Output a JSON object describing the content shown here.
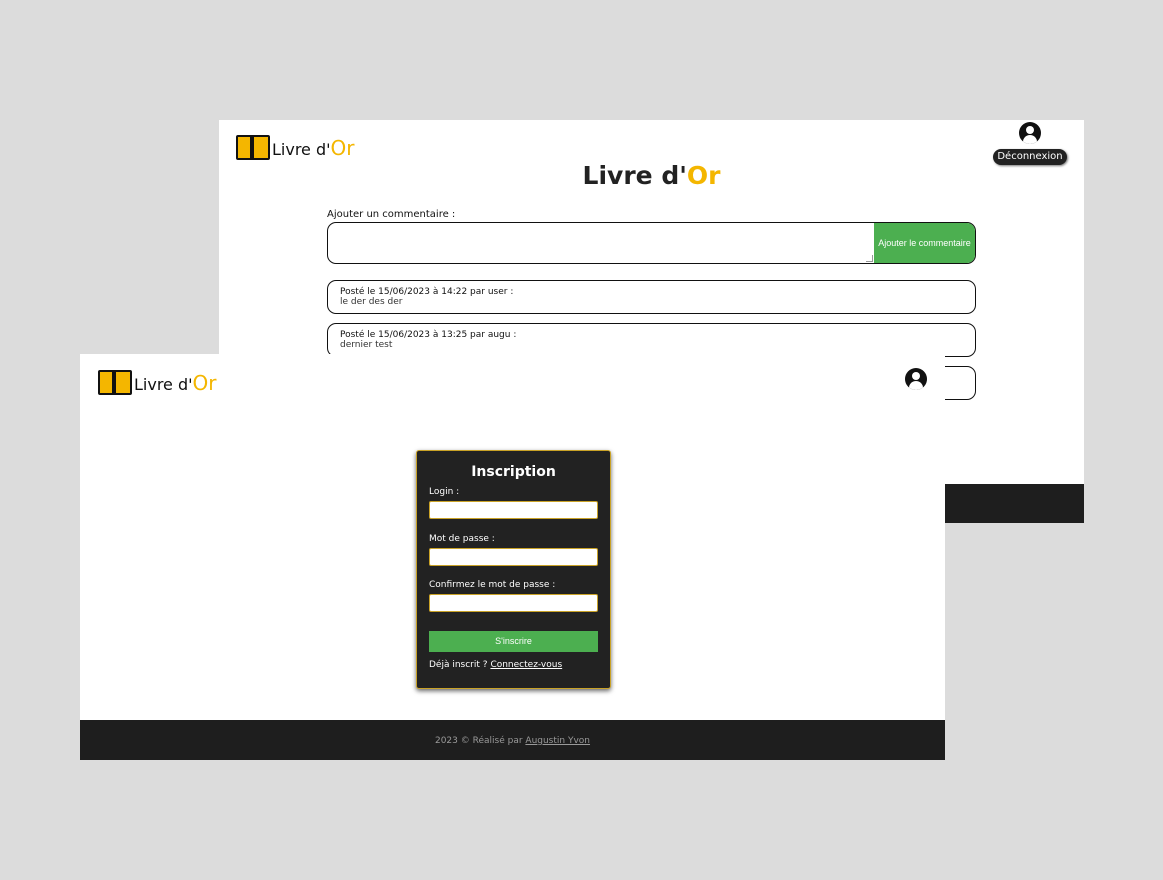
{
  "brand": {
    "name_prefix": "Livre d'",
    "name_accent": "O",
    "name_suffix": "r",
    "accent_color": "#f4b600"
  },
  "back_page": {
    "logout_label": "Déconnexion",
    "title_prefix": "Livre d'",
    "title_accent": "Or",
    "add_comment_label": "Ajouter un commentaire :",
    "add_comment_button": "Ajouter le commentaire",
    "comments": [
      {
        "meta": "Posté le 15/06/2023 à 14:22 par user :",
        "text": "le der des der"
      },
      {
        "meta": "Posté le 15/06/2023 à 13:25 par augu :",
        "text": "dernier test"
      }
    ]
  },
  "front_page": {
    "form": {
      "title": "Inscription",
      "login_label": "Login :",
      "password_label": "Mot de passe :",
      "confirm_label": "Confirmez le mot de passe :",
      "submit_label": "S'inscrire",
      "already_text": "Déjà inscrit ?",
      "login_link": "Connectez-vous"
    },
    "footer": {
      "text": "2023 © Réalisé par",
      "author": "Augustin Yvon"
    }
  },
  "colors": {
    "button_green": "#4caf50",
    "footer_dark": "#1e1e1e",
    "form_bg": "#222222",
    "form_border": "#c9a227"
  }
}
